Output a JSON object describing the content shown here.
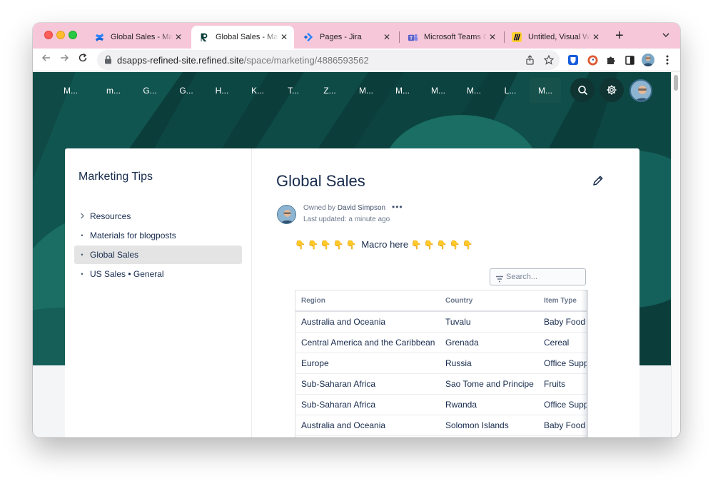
{
  "browser": {
    "tabs": [
      {
        "title": "Global Sales - Marketing Tips",
        "icon": "confluence-icon",
        "active": false
      },
      {
        "title": "Global Sales - Marketing Tips",
        "icon": "refined-icon",
        "active": true
      },
      {
        "title": "Pages - Jira",
        "icon": "jira-icon",
        "active": false
      },
      {
        "title": "Microsoft Teams Classic",
        "icon": "teams-icon",
        "active": false
      },
      {
        "title": "Untitled, Visual Workspace",
        "icon": "miro-icon",
        "active": false
      }
    ],
    "close_glyph": "✕",
    "new_tab_glyph": "+",
    "tab_menu_glyph": "⌄",
    "url_host": "dsapps-refined-site.refined.site",
    "url_path": "/space/marketing/4886593562",
    "colors": {
      "tabstrip": "#f6c7d8",
      "header": "#0b3d3b",
      "accent_teal": "#1a6e63"
    }
  },
  "site_nav": {
    "items": [
      "M...",
      "m...",
      "G...",
      "G...",
      "H...",
      "K...",
      "T...",
      "Z...",
      "M...",
      "M...",
      "M...",
      "M...",
      "L...",
      "M..."
    ],
    "active_index": 13,
    "search_icon": "search-icon",
    "settings_icon": "gear-icon"
  },
  "sidebar": {
    "space_title": "Marketing Tips",
    "items": [
      {
        "label": "Resources",
        "marker": "›"
      },
      {
        "label": "Materials for blogposts",
        "marker": "•"
      },
      {
        "label": "Global Sales",
        "marker": "•",
        "selected": true
      },
      {
        "label": "US Sales • General",
        "marker": "•"
      }
    ]
  },
  "page": {
    "title": "Global Sales",
    "owned_prefix": "Owned by",
    "owner": "David Simpson",
    "more": "•••",
    "last_updated": "Last updated: a minute ago",
    "macro_emoji_left": "👇👇👇👇👇",
    "macro_text": "Macro here",
    "macro_emoji_right": "👇👇👇👇👇",
    "search_placeholder": "Search..."
  },
  "table": {
    "columns": [
      "Region",
      "Country",
      "Item Type"
    ],
    "rows": [
      [
        "Australia and Oceania",
        "Tuvalu",
        "Baby Food"
      ],
      [
        "Central America and the Caribbean",
        "Grenada",
        "Cereal"
      ],
      [
        "Europe",
        "Russia",
        "Office Supplies"
      ],
      [
        "Sub-Saharan Africa",
        "Sao Tome and Principe",
        "Fruits"
      ],
      [
        "Sub-Saharan Africa",
        "Rwanda",
        "Office Supplies"
      ],
      [
        "Australia and Oceania",
        "Solomon Islands",
        "Baby Food"
      ],
      [
        "",
        "",
        ""
      ]
    ]
  }
}
